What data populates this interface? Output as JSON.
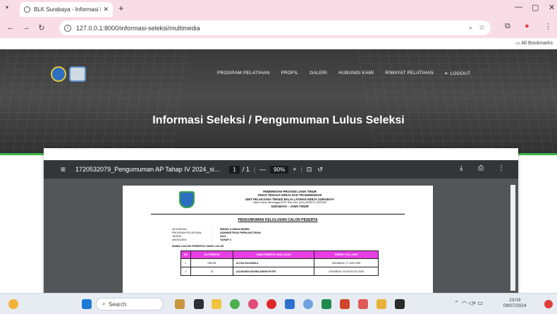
{
  "browser": {
    "tab_title": "BLK Surabaya - Informasi Pelati",
    "url": "127.0.0.1:8000/informasi-seleksi/multimedia",
    "bookmarks_label": "All Bookmarks"
  },
  "site": {
    "menu": [
      "PROGRAM PELATIHAN",
      "PROFIL",
      "GALERI",
      "HUBUNGI KAMI",
      "RIWAYAT PELATIHAN",
      "LOGOUT"
    ],
    "heading": "Informasi Seleksi / Pengumuman Lulus Seleksi"
  },
  "pdf": {
    "filename": "1720532079_Pengumuman AP Tahap IV 2024_si...",
    "page_current": "1",
    "page_total": "/ 1",
    "zoom": "90%",
    "letterhead": [
      "PEMERINTAH PROVINSI JAWA TIMUR",
      "DINAS TENAGA KERJA DAN TRANSMIGRASI",
      "UNIT PELAKSANA TEKNIS BALAI LATIHAN KERJA SURABAYA",
      "Jalan Dukuh Menanggal III/29 Telp./Fax. (031) 8290071, 8287532",
      "SURABAYA – JAWA TIMUR"
    ],
    "announcement_title": "PENGUMUMAN KELULUSAN CALON PESERTA",
    "meta": [
      {
        "k": "KEJURUAN",
        "v": "BISNIS & MANAJEMEN"
      },
      {
        "k": "PROGRAM PELATIHAN",
        "v": "ADMINISTRASI PERKANTORAN"
      },
      {
        "k": "TAHUN",
        "v": "2024"
      },
      {
        "k": "ANGKATAN",
        "v": "TAHAP 4"
      }
    ],
    "list_title": "NAMA CALON PESERTA YANG LULUS",
    "table_headers": [
      "NO",
      "NO.PESERTA",
      "NAMA PESERTA YANG LULUS",
      "TEMPAT /TGL LAHIR"
    ],
    "table_rows": [
      [
        "1",
        "ONLINE",
        "ALYSA SALSABILA",
        "SURABAYA, 27 JUNI 2006"
      ],
      [
        "2",
        "31",
        "AZZAHARA NADWA ANDINI PUTRI",
        "SURABAYA, 05 AGUSTUS 2005"
      ]
    ]
  },
  "taskbar": {
    "search_placeholder": "Search",
    "time": "23:03",
    "date": "09/07/2024"
  },
  "colors": {
    "browser_chrome": "#f9dde6",
    "table_header": "#e83fe5",
    "accent_green": "#3cb44b"
  }
}
